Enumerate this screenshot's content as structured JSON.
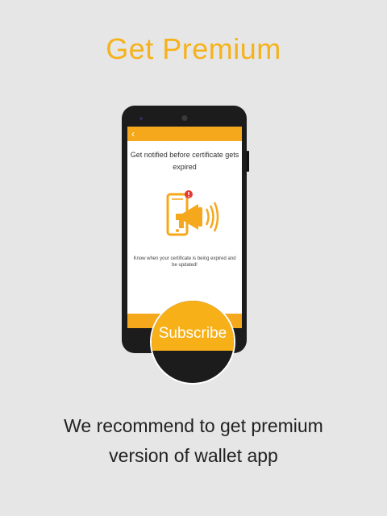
{
  "page": {
    "title": "Get Premium",
    "recommend_text": "We recommend to get premium version of wallet app"
  },
  "phone_screen": {
    "back_icon": "chevron-left-icon",
    "headline": "Get notified before certificate gets expired",
    "description": "Know when your certificate is being expired and be updated!",
    "illustration": "phone-megaphone-notification-icon"
  },
  "subscribe": {
    "label": "Subscribe"
  },
  "colors": {
    "accent": "#f5b21c",
    "background": "#e6e6e6",
    "phone_body": "#1c1c1c"
  }
}
